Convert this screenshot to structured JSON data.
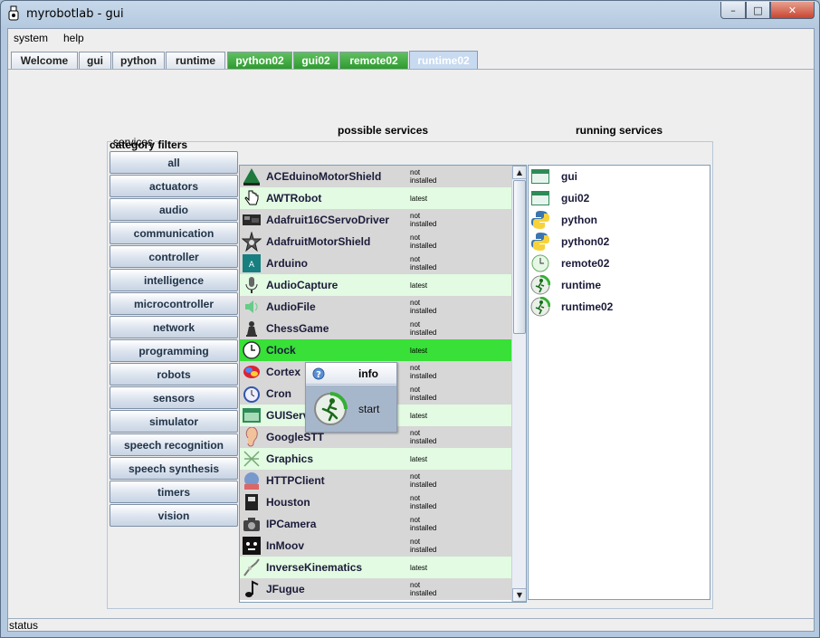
{
  "window": {
    "title": "myrobotlab - gui",
    "min": "–",
    "max": "□",
    "close": "✕"
  },
  "menu": [
    "system",
    "help"
  ],
  "tabs": [
    {
      "label": "Welcome",
      "style": "plain"
    },
    {
      "label": "gui",
      "style": "plain"
    },
    {
      "label": "python",
      "style": "plain"
    },
    {
      "label": "runtime",
      "style": "plain"
    },
    {
      "label": "python02",
      "style": "green"
    },
    {
      "label": "gui02",
      "style": "green"
    },
    {
      "label": "remote02",
      "style": "green"
    },
    {
      "label": "runtime02",
      "style": "selected"
    }
  ],
  "services_panel": {
    "legend": "services",
    "category_filters_label": "category filters",
    "possible_label": "possible services",
    "running_label": "running services"
  },
  "filters": [
    "all",
    "actuators",
    "audio",
    "communication",
    "controller",
    "intelligence",
    "microcontroller",
    "network",
    "programming",
    "robots",
    "sensors",
    "simulator",
    "speech recognition",
    "speech synthesis",
    "timers",
    "vision"
  ],
  "possible_services": [
    {
      "name": "ACEduinoMotorShield",
      "status": "not installed",
      "icon": "arduino-triangle-icon"
    },
    {
      "name": "AWTRobot",
      "status": "latest",
      "icon": "hand-cursor-icon"
    },
    {
      "name": "Adafruit16CServoDriver",
      "status": "not installed",
      "icon": "circuit-board-icon"
    },
    {
      "name": "AdafruitMotorShield",
      "status": "not installed",
      "icon": "gear-star-icon"
    },
    {
      "name": "Arduino",
      "status": "not installed",
      "icon": "arduino-board-icon"
    },
    {
      "name": "AudioCapture",
      "status": "latest",
      "icon": "microphone-icon"
    },
    {
      "name": "AudioFile",
      "status": "not installed",
      "icon": "speaker-icon"
    },
    {
      "name": "ChessGame",
      "status": "not installed",
      "icon": "chess-piece-icon"
    },
    {
      "name": "Clock",
      "status": "latest",
      "icon": "clock-icon"
    },
    {
      "name": "Cortex",
      "status": "not installed",
      "icon": "brain-icon"
    },
    {
      "name": "Cron",
      "status": "not installed",
      "icon": "stopwatch-icon"
    },
    {
      "name": "GUIService",
      "status": "latest",
      "icon": "window-icon"
    },
    {
      "name": "GoogleSTT",
      "status": "not installed",
      "icon": "ear-icon"
    },
    {
      "name": "Graphics",
      "status": "latest",
      "icon": "graphics-icon"
    },
    {
      "name": "HTTPClient",
      "status": "not installed",
      "icon": "globe-http-icon"
    },
    {
      "name": "Houston",
      "status": "not installed",
      "icon": "robot-icon"
    },
    {
      "name": "IPCamera",
      "status": "not installed",
      "icon": "camera-icon"
    },
    {
      "name": "InMoov",
      "status": "not installed",
      "icon": "inmoov-face-icon"
    },
    {
      "name": "InverseKinematics",
      "status": "latest",
      "icon": "arm-icon"
    },
    {
      "name": "JFugue",
      "status": "not installed",
      "icon": "music-note-icon"
    }
  ],
  "selected_service": "Clock",
  "popup": {
    "info_label": "info",
    "start_label": "start"
  },
  "running_services": [
    {
      "name": "gui",
      "icon": "gui-window-icon"
    },
    {
      "name": "gui02",
      "icon": "gui-window-icon"
    },
    {
      "name": "python",
      "icon": "python-icon"
    },
    {
      "name": "python02",
      "icon": "python-icon"
    },
    {
      "name": "remote02",
      "icon": "remote-clock-icon"
    },
    {
      "name": "runtime",
      "icon": "runtime-runner-icon"
    },
    {
      "name": "runtime02",
      "icon": "runtime-runner-icon"
    }
  ],
  "status_bar": "status",
  "colors": {
    "green_tab": "#2f9a2f",
    "selected_tab": "#c8daf0",
    "highlight_row": "#38e038",
    "latest_row": "#e2fbe2",
    "not_installed_row": "#d7d7d7"
  }
}
